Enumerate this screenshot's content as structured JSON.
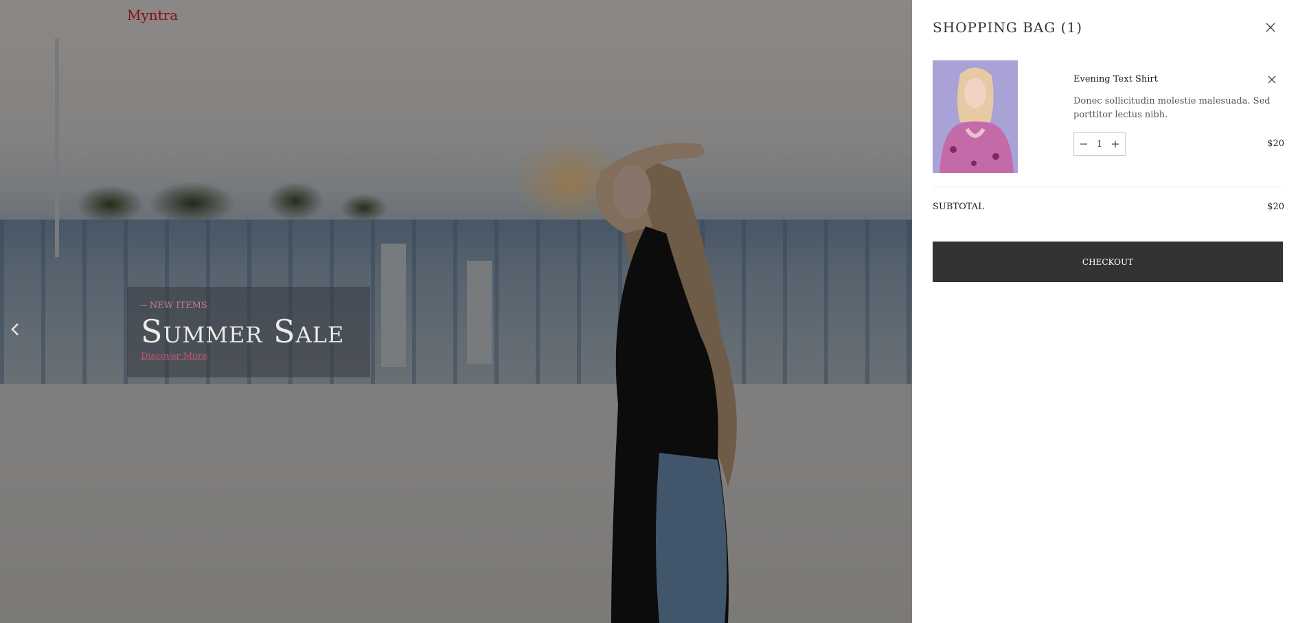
{
  "header": {
    "brand": "Myntra"
  },
  "hero": {
    "kicker": "-- NEW ITEMS",
    "title": "Summer Sale",
    "link_label": "Discover More",
    "prev_icon": "chevron-left-icon"
  },
  "cart": {
    "title": "Shopping Bag (1)",
    "close_icon": "close-icon",
    "items": [
      {
        "name": "Evening Text Shirt",
        "description": "Donec sollicitudin molestie malesuada. Sed porttitor lectus nibh.",
        "quantity": "1",
        "price": "$20",
        "remove_icon": "close-icon"
      }
    ],
    "subtotal_label": "SUBTOTAL",
    "subtotal_value": "$20",
    "checkout_label": "CHECKOUT"
  },
  "colors": {
    "brand": "#8b0d1a",
    "checkout_bg": "#333333",
    "link": "#c2566c"
  }
}
